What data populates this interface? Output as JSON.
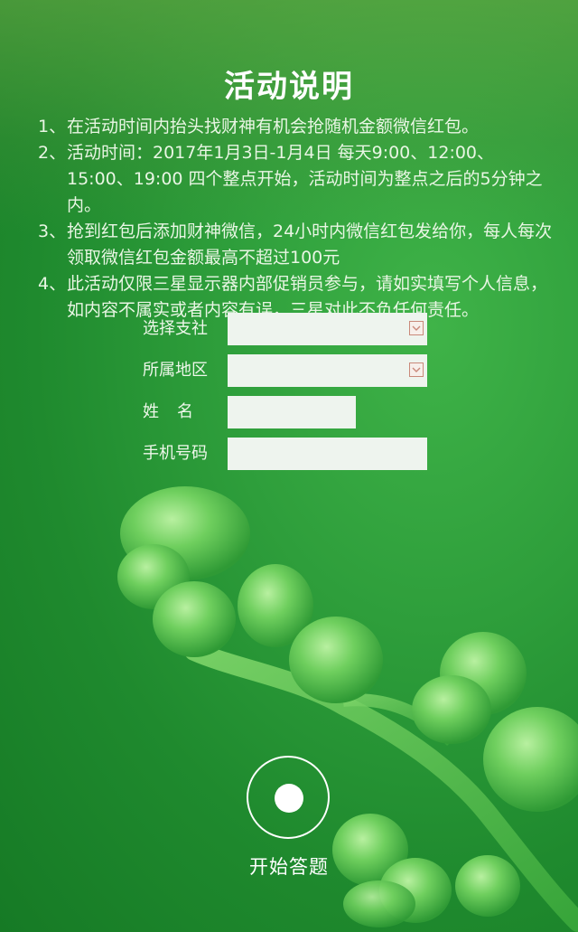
{
  "title": "活动说明",
  "rules": [
    {
      "num": "1、",
      "text": "在活动时间内抬头找财神有机会抢随机金额微信红包。"
    },
    {
      "num": "2、",
      "text": "活动时间：2017年1月3日-1月4日 每天9:00、12:00、15:00、19:00 四个整点开始，活动时间为整点之后的5分钟之内。"
    },
    {
      "num": "3、",
      "text": "抢到红包后添加财神微信，24小时内微信红包发给你，每人每次领取微信红包金额最高不超过100元"
    },
    {
      "num": "4、",
      "text": "此活动仅限三星显示器内部促销员参与，请如实填写个人信息，如内容不属实或者内容有误，三星对此不负任何责任。"
    }
  ],
  "form": {
    "branch_label": "选择支社",
    "region_label": "所属地区",
    "name_label": "姓名",
    "phone_label": "手机号码",
    "branch_value": "",
    "region_value": "",
    "name_value": "",
    "phone_value": ""
  },
  "start_label": "开始答题",
  "colors": {
    "background": "#2e9e3b",
    "field_bg": "#eef4ee",
    "dropdown_border": "#c9897a"
  },
  "icons": {
    "dropdown": "chevron-down-icon",
    "start": "record-circle-icon"
  }
}
